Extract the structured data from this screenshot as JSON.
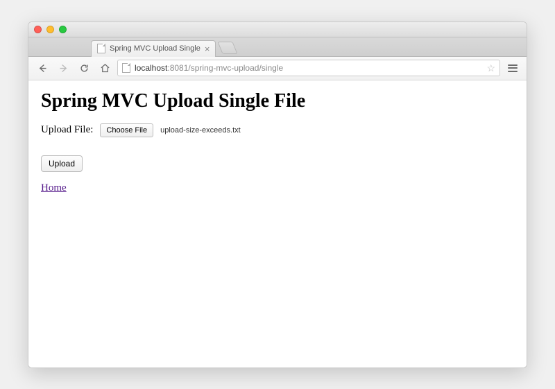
{
  "tab": {
    "title": "Spring MVC Upload Single"
  },
  "address": {
    "host": "localhost",
    "path": ":8081/spring-mvc-upload/single"
  },
  "page": {
    "heading": "Spring MVC Upload Single File",
    "upload_label": "Upload File:",
    "choose_button": "Choose File",
    "selected_file": "upload-size-exceeds.txt",
    "submit_button": "Upload",
    "home_link": "Home"
  }
}
